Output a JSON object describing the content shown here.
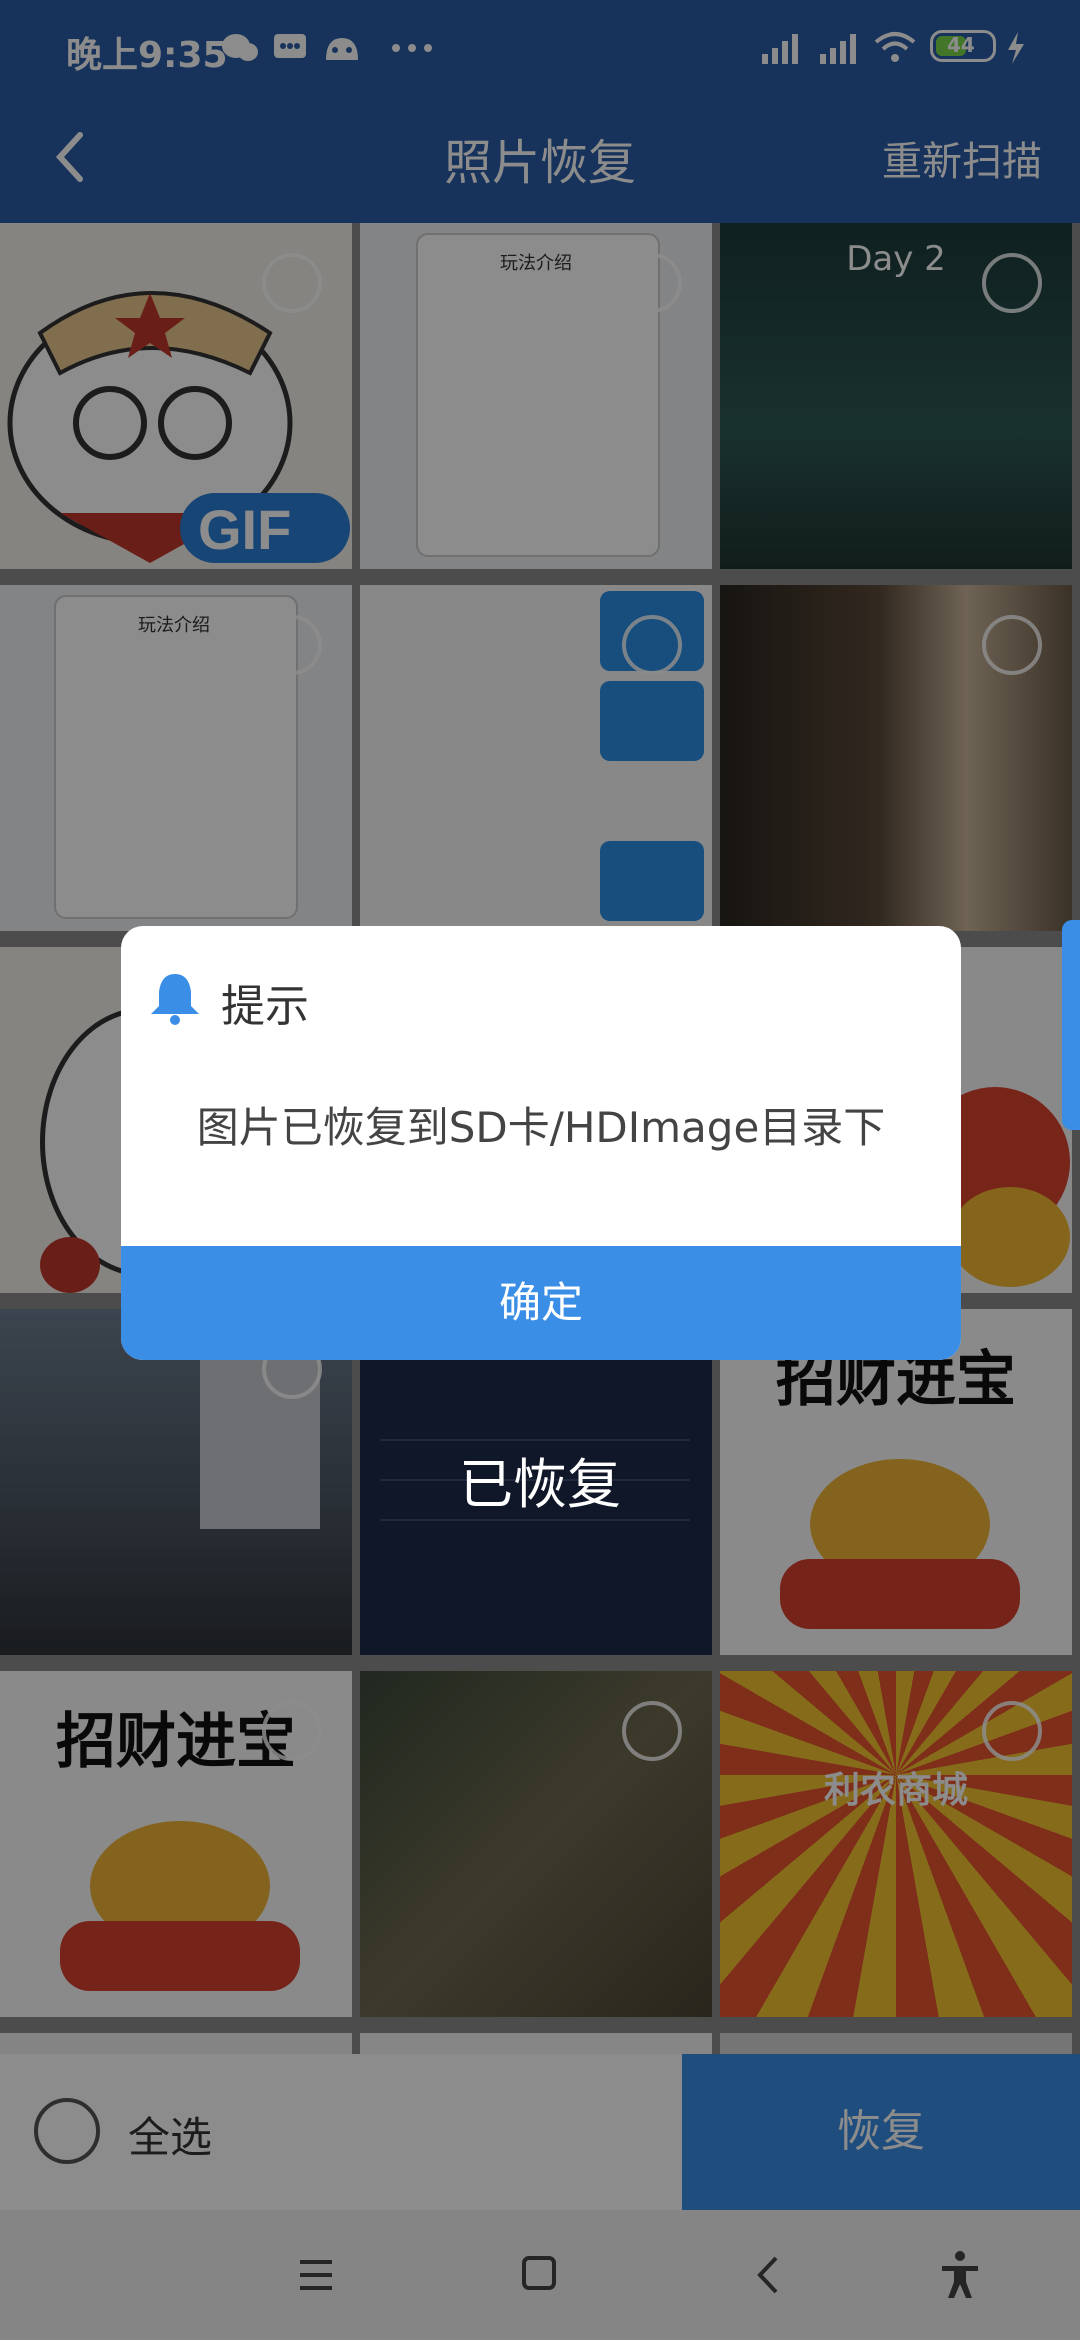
{
  "status": {
    "time": "晚上9:35",
    "battery": "44"
  },
  "header": {
    "title": "照片恢复",
    "rescan": "重新扫描"
  },
  "grid": {
    "tiles": [
      {
        "label": "GIF"
      },
      {
        "label": "玩法介绍"
      },
      {
        "label": "Day 2"
      },
      {
        "label": "玩法介绍"
      },
      {
        "label": ""
      },
      {
        "label": ""
      },
      {
        "label": ""
      },
      {
        "label": ""
      },
      {
        "label": ""
      },
      {
        "label": ""
      },
      {
        "label": ""
      },
      {
        "label": "招财进宝"
      },
      {
        "label": "招财进宝"
      },
      {
        "label": ""
      },
      {
        "label": "利农商城"
      }
    ],
    "restored_overlay": "已恢复"
  },
  "bottom": {
    "select_all": "全选",
    "restore": "恢复"
  },
  "dialog": {
    "title": "提示",
    "message": "图片已恢复到SD卡/HDImage目录下",
    "confirm": "确定"
  },
  "colors": {
    "primary": "#3a8ee6",
    "header": "#2a5ea8"
  }
}
